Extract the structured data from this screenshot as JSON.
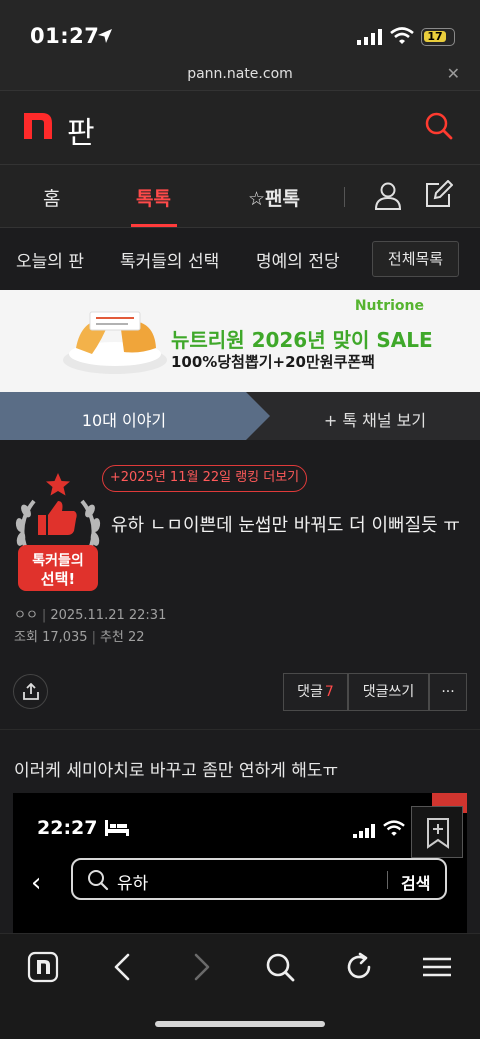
{
  "status_bar": {
    "time": "01:27",
    "battery": "17"
  },
  "browser": {
    "url": "pann.nate.com",
    "close_icon": "close-icon"
  },
  "header": {
    "logo": "n",
    "brand": "판",
    "accent": "#ff3b30"
  },
  "nav": {
    "tabs": [
      {
        "label": "홈"
      },
      {
        "label": "톡톡",
        "active": true
      },
      {
        "label": "팬톡"
      }
    ]
  },
  "subnav": {
    "items": [
      "오늘의 판",
      "톡커들의 선택",
      "명예의 전당"
    ],
    "all_button": "전체목록"
  },
  "banner": {
    "brand": "Nutrione",
    "headline": "뉴트리원 2026년 맞이 SALE",
    "subline": "100%당첨뽑기+20만원쿠폰팩"
  },
  "story_tabs": {
    "left": "10대 이야기",
    "right": "+ 톡 채널 보기"
  },
  "post": {
    "ranking_link": "+2025년 11월 22일 랭킹 더보기",
    "badge_text_1": "톡커들의",
    "badge_text_2": "선택!",
    "title": "유하 ㄴㅁ이쁜데 눈썹만 바꿔도 더 이뻐질듯 ㅠ",
    "author": "ㅇㅇ",
    "date": "2025.11.21 22:31",
    "views_label": "조회",
    "views": "17,035",
    "recommend_label": "추천",
    "recommend": "22",
    "comment_label": "댓글",
    "comment_count": "7",
    "write_comment": "댓글쓰기",
    "more": "···",
    "body": "이러케 세미아치로 바꾸고 좀만 연하게 해도ㅠ"
  },
  "embedded_image": {
    "time": "22:27",
    "search_query": "유하",
    "search_button": "검색"
  }
}
